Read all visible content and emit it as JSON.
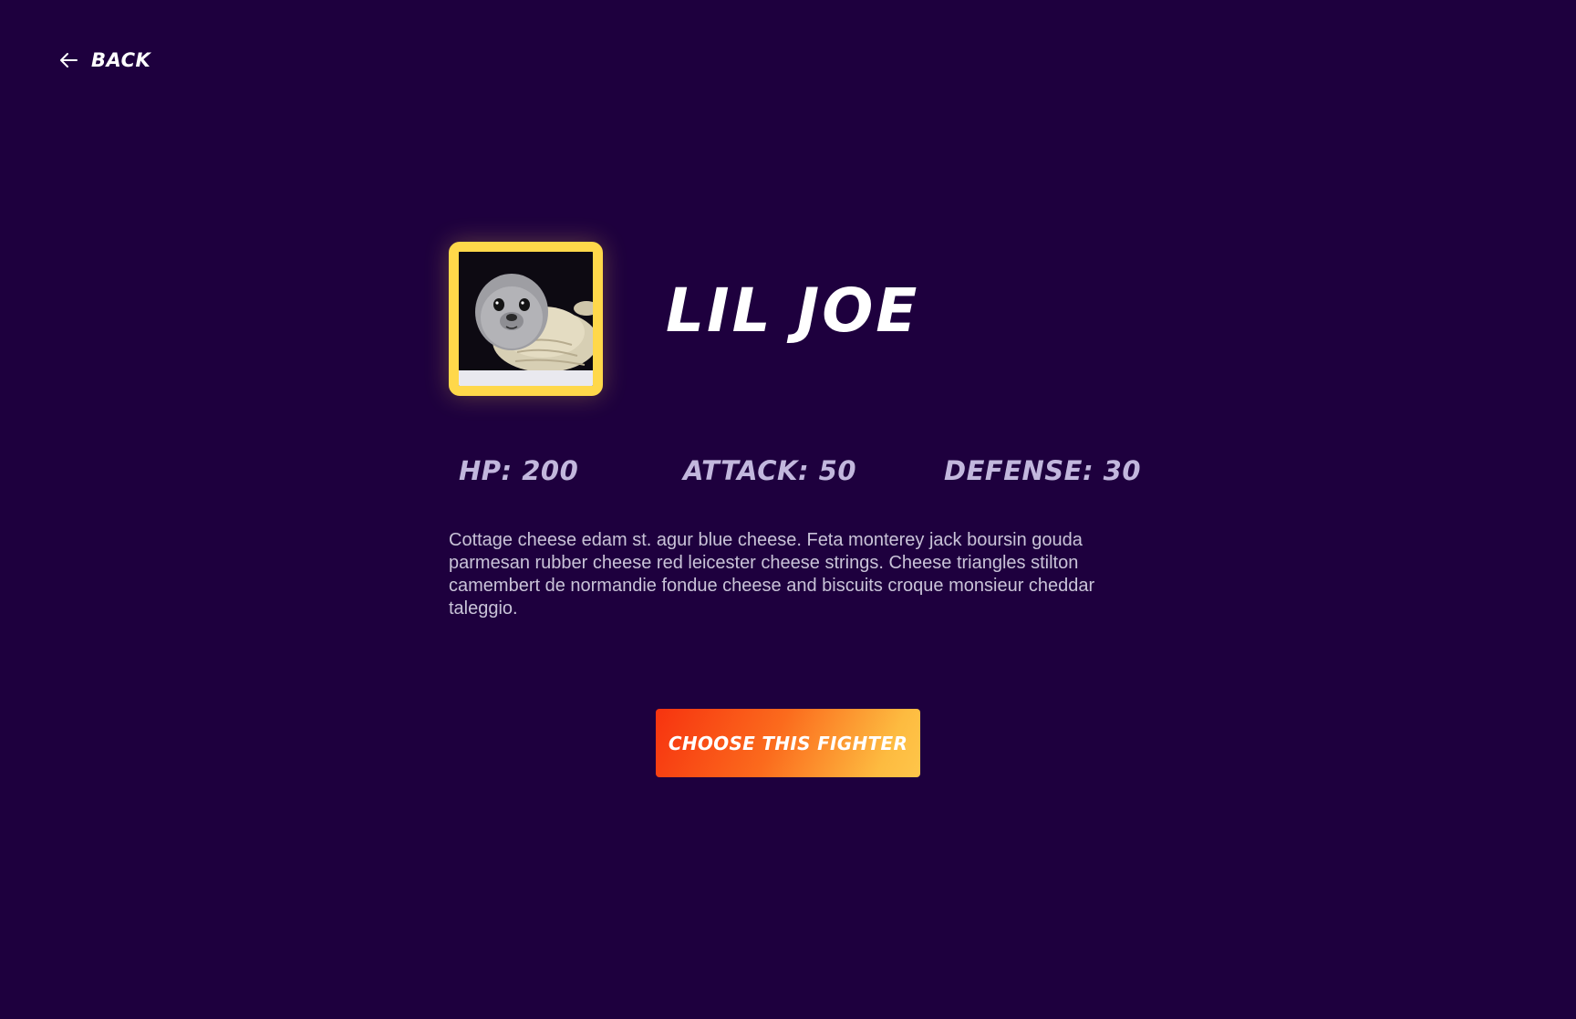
{
  "nav": {
    "back_label": "Back",
    "back_icon": "arrow-left-icon"
  },
  "fighter": {
    "name": "Lil Joe",
    "portrait": "seal-pup-photo",
    "stats": {
      "hp": "HP: 200",
      "attack": "Attack: 50",
      "defense": "Defense: 30"
    },
    "description": "Cottage cheese edam st. agur blue cheese. Feta monterey jack boursin gouda parmesan rubber cheese red leicester cheese strings. Cheese triangles stilton camembert de normandie fondue cheese and biscuits croque monsieur cheddar taleggio."
  },
  "actions": {
    "choose_label": "Choose this fighter"
  },
  "colors": {
    "background": "#1e003e",
    "frame": "#ffd84a",
    "stat_text": "#c2b7dd",
    "button_start": "#f7330f",
    "button_end": "#ffc64a"
  }
}
